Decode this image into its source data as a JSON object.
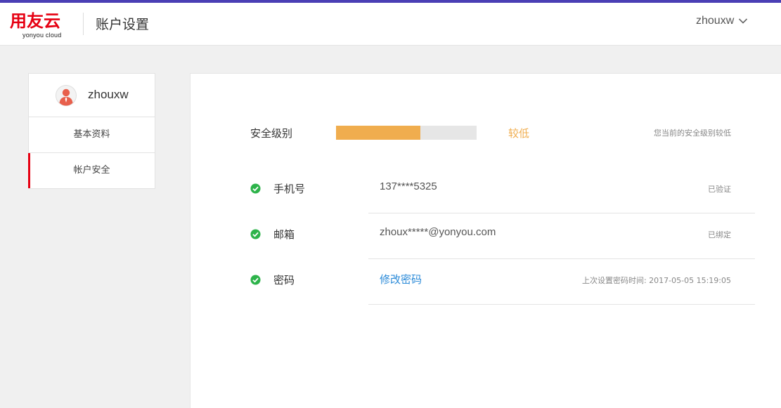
{
  "header": {
    "logo_cn": "用友云",
    "logo_en": "yonyou cloud",
    "title": "账户设置",
    "user_name": "zhouxw"
  },
  "sidebar": {
    "user_name": "zhouxw",
    "items": [
      {
        "label": "基本资料",
        "active": false
      },
      {
        "label": "帐户安全",
        "active": true
      }
    ]
  },
  "security": {
    "label": "安全级别",
    "level_fraction": 0.6,
    "level_text": "较低",
    "note": "您当前的安全级别较低",
    "rows": [
      {
        "label": "手机号",
        "value": "137****5325",
        "status": "已验证"
      },
      {
        "label": "邮箱",
        "value": "zhoux*****@yonyou.com",
        "status": "已绑定"
      },
      {
        "label": "密码",
        "value": "修改密码",
        "status": "上次设置密码时间: 2017-05-05 15:19:05"
      }
    ]
  },
  "colors": {
    "accent_top": "#4a3fb5",
    "brand_red": "#e60012",
    "level_orange": "#f0ad4e",
    "check_green": "#2db34a",
    "link_blue": "#2a8ad8"
  },
  "icons": {
    "user_menu": "chevron-down-icon",
    "avatar": "user-avatar-icon",
    "row_status": "check-circle-icon"
  }
}
